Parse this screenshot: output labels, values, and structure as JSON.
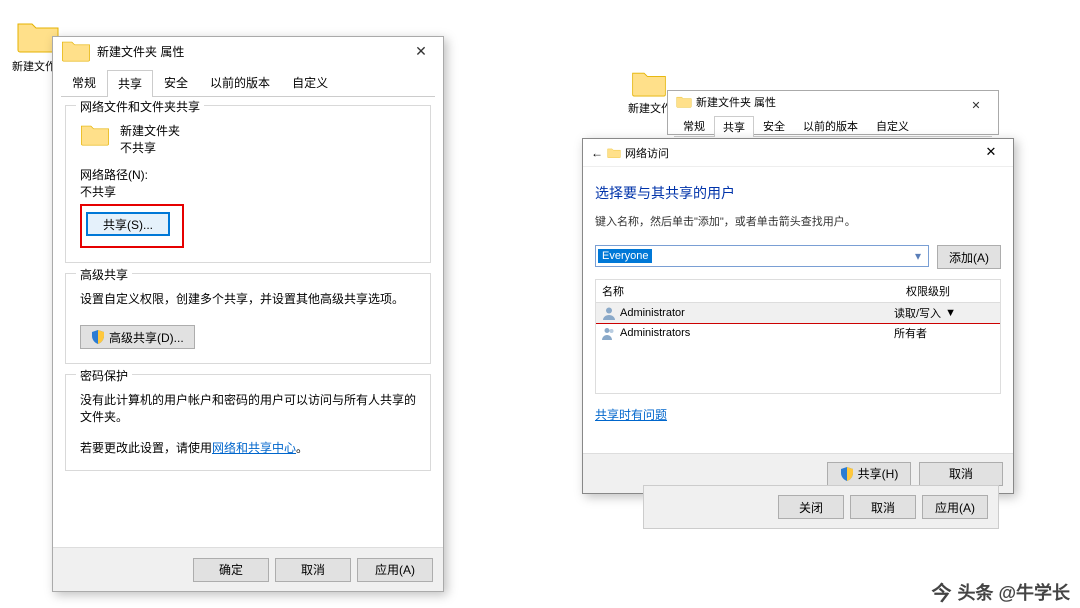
{
  "desktop": {
    "folder1_label": "新建文作",
    "folder2_label": "新建文作"
  },
  "dlg1": {
    "title": "新建文件夹 属性",
    "tabs": [
      "常规",
      "共享",
      "安全",
      "以前的版本",
      "自定义"
    ],
    "active_tab": 1,
    "group1": {
      "title": "网络文件和文件夹共享",
      "folder_name": "新建文件夹",
      "status": "不共享",
      "path_label": "网络路径(N):",
      "path_value": "不共享",
      "share_btn": "共享(S)..."
    },
    "group2": {
      "title": "高级共享",
      "desc": "设置自定义权限，创建多个共享，并设置其他高级共享选项。",
      "adv_btn": "高级共享(D)..."
    },
    "group3": {
      "title": "密码保护",
      "line1": "没有此计算机的用户帐户和密码的用户可以访问与所有人共享的文件夹。",
      "line2_prefix": "若要更改此设置，请使用",
      "link": "网络和共享中心",
      "line2_suffix": "。"
    },
    "footer": {
      "ok": "确定",
      "cancel": "取消",
      "apply": "应用(A)"
    }
  },
  "dlg2": {
    "title": "新建文件夹 属性",
    "tabs": [
      "常规",
      "共享",
      "安全",
      "以前的版本",
      "自定义"
    ],
    "active_tab": 1
  },
  "dlg3": {
    "breadcrumb": "网络访问",
    "heading": "选择要与其共享的用户",
    "hint": "键入名称，然后单击\"添加\"，或者单击箭头查找用户。",
    "combo_value": "Everyone",
    "add_btn": "添加(A)",
    "col_name": "名称",
    "col_perm": "权限级别",
    "rows": [
      {
        "name": "Administrator",
        "perm": "读取/写入",
        "highlight": true,
        "has_dropdown": true
      },
      {
        "name": "Administrators",
        "perm": "所有者",
        "highlight": false,
        "has_dropdown": false
      }
    ],
    "help_link": "共享时有问题",
    "footer": {
      "share": "共享(H)",
      "cancel": "取消"
    }
  },
  "dlg4": {
    "close": "关闭",
    "cancel": "取消",
    "apply": "应用(A)"
  },
  "watermark": "头条 @牛学长"
}
